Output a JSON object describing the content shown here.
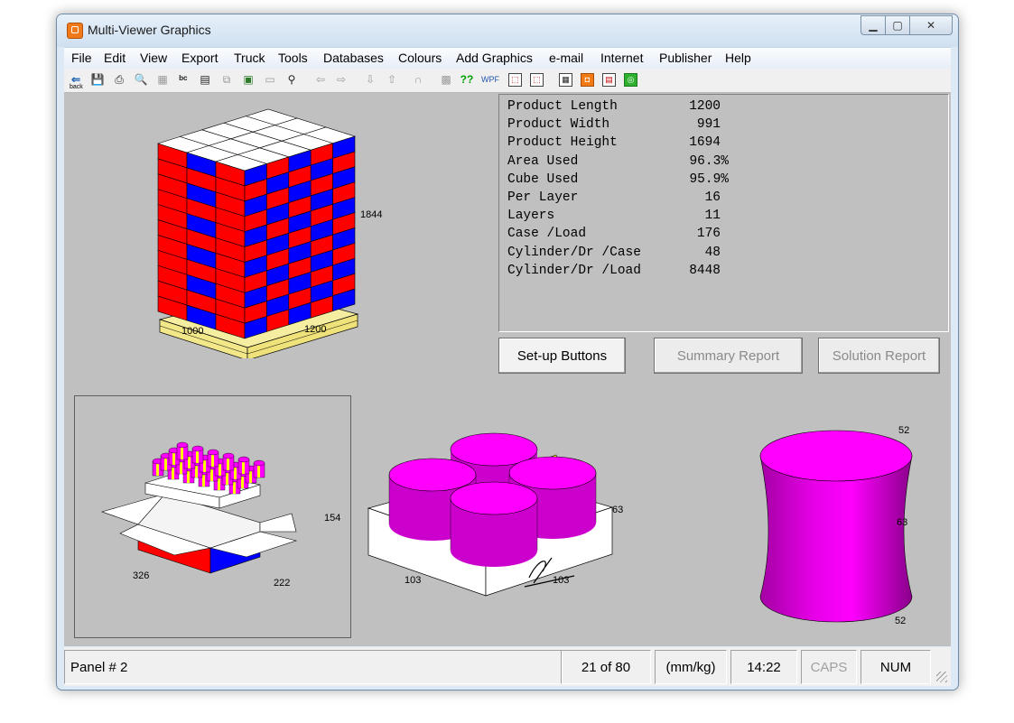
{
  "window": {
    "title": "Multi-Viewer Graphics",
    "min_glyph": "▁",
    "max_glyph": "▢",
    "close_glyph": "✕"
  },
  "menu": [
    "File",
    "Edit",
    "View",
    "Export",
    "Truck",
    "Tools",
    "Databases",
    "Colours",
    "Add Graphics",
    "e-mail",
    "Internet",
    "Publisher",
    "Help"
  ],
  "toolbar": {
    "back_label": "back",
    "tools": [
      {
        "name": "back-icon",
        "glyph": "⇐"
      },
      {
        "name": "save-icon",
        "glyph": "💾"
      },
      {
        "name": "print-icon",
        "glyph": "⎙"
      },
      {
        "name": "print-preview-icon",
        "glyph": "🔍"
      },
      {
        "name": "layout-icon",
        "glyph": "▦"
      },
      {
        "name": "text-icon",
        "glyph": "ᵇᶜ"
      },
      {
        "name": "document-icon",
        "glyph": "▤"
      },
      {
        "name": "copy-icon",
        "glyph": "⧉"
      },
      {
        "name": "image-icon",
        "glyph": "▣"
      },
      {
        "name": "panel-icon",
        "glyph": "▭"
      },
      {
        "name": "zoom-icon",
        "glyph": "⚲"
      },
      {
        "name": "arrow-left-icon",
        "glyph": "⇦"
      },
      {
        "name": "arrow-right-icon",
        "glyph": "⇨"
      },
      {
        "name": "arrow-down-icon",
        "glyph": "⇩"
      },
      {
        "name": "arrow-up-icon",
        "glyph": "⇧"
      },
      {
        "name": "rotate-icon",
        "glyph": "∩"
      },
      {
        "name": "grid-icon",
        "glyph": "▩"
      },
      {
        "name": "help-icon",
        "glyph": "??"
      },
      {
        "name": "wpf-icon",
        "glyph": "WPF"
      },
      {
        "name": "pdf-icon",
        "glyph": "⬚"
      },
      {
        "name": "pdf-export-icon",
        "glyph": "⬚"
      },
      {
        "name": "table-icon",
        "glyph": "▦"
      },
      {
        "name": "orange-cube-icon",
        "glyph": "◘"
      },
      {
        "name": "report-icon",
        "glyph": "▤"
      },
      {
        "name": "green-circle-icon",
        "glyph": "◎"
      }
    ]
  },
  "summary": {
    "rows": [
      {
        "label": "Product Length",
        "value": "1200"
      },
      {
        "label": "Product Width",
        "value": "991"
      },
      {
        "label": "Product Height",
        "value": "1694"
      },
      {
        "label": "Area Used",
        "value": "96.3%"
      },
      {
        "label": "Cube Used",
        "value": "95.9%"
      },
      {
        "label": "Per Layer",
        "value": "16"
      },
      {
        "label": "Layers",
        "value": "11"
      },
      {
        "label": "Case /Load",
        "value": "176"
      },
      {
        "label": "Cylinder/Dr /Case",
        "value": "48"
      },
      {
        "label": "Cylinder/Dr /Load",
        "value": "8448"
      }
    ]
  },
  "buttons": {
    "setup": "Set-up Buttons",
    "summary": "Summary Report",
    "solution": "Solution Report"
  },
  "pallet": {
    "height_label": "1844",
    "width_label": "1000",
    "length_label": "1200",
    "colors": {
      "red": "#ff0000",
      "blue": "#0000ff",
      "top": "#ffffff",
      "pallet": "#f5eea0"
    }
  },
  "case_view": {
    "height_label": "154",
    "width_label": "326",
    "depth_label": "222"
  },
  "tray_view": {
    "left_label": "103",
    "right_label": "103",
    "height_label": "63",
    "colors": {
      "product": "#ff00ff",
      "divider": "#ffff00",
      "tray": "#ffffff"
    }
  },
  "cylinder_view": {
    "top_label": "52",
    "bottom_label": "52",
    "height_label": "63"
  },
  "status": {
    "panel": "Panel # 2",
    "page": "21 of 80",
    "units": "(mm/kg)",
    "time": "14:22",
    "caps": "CAPS",
    "num": "NUM"
  }
}
